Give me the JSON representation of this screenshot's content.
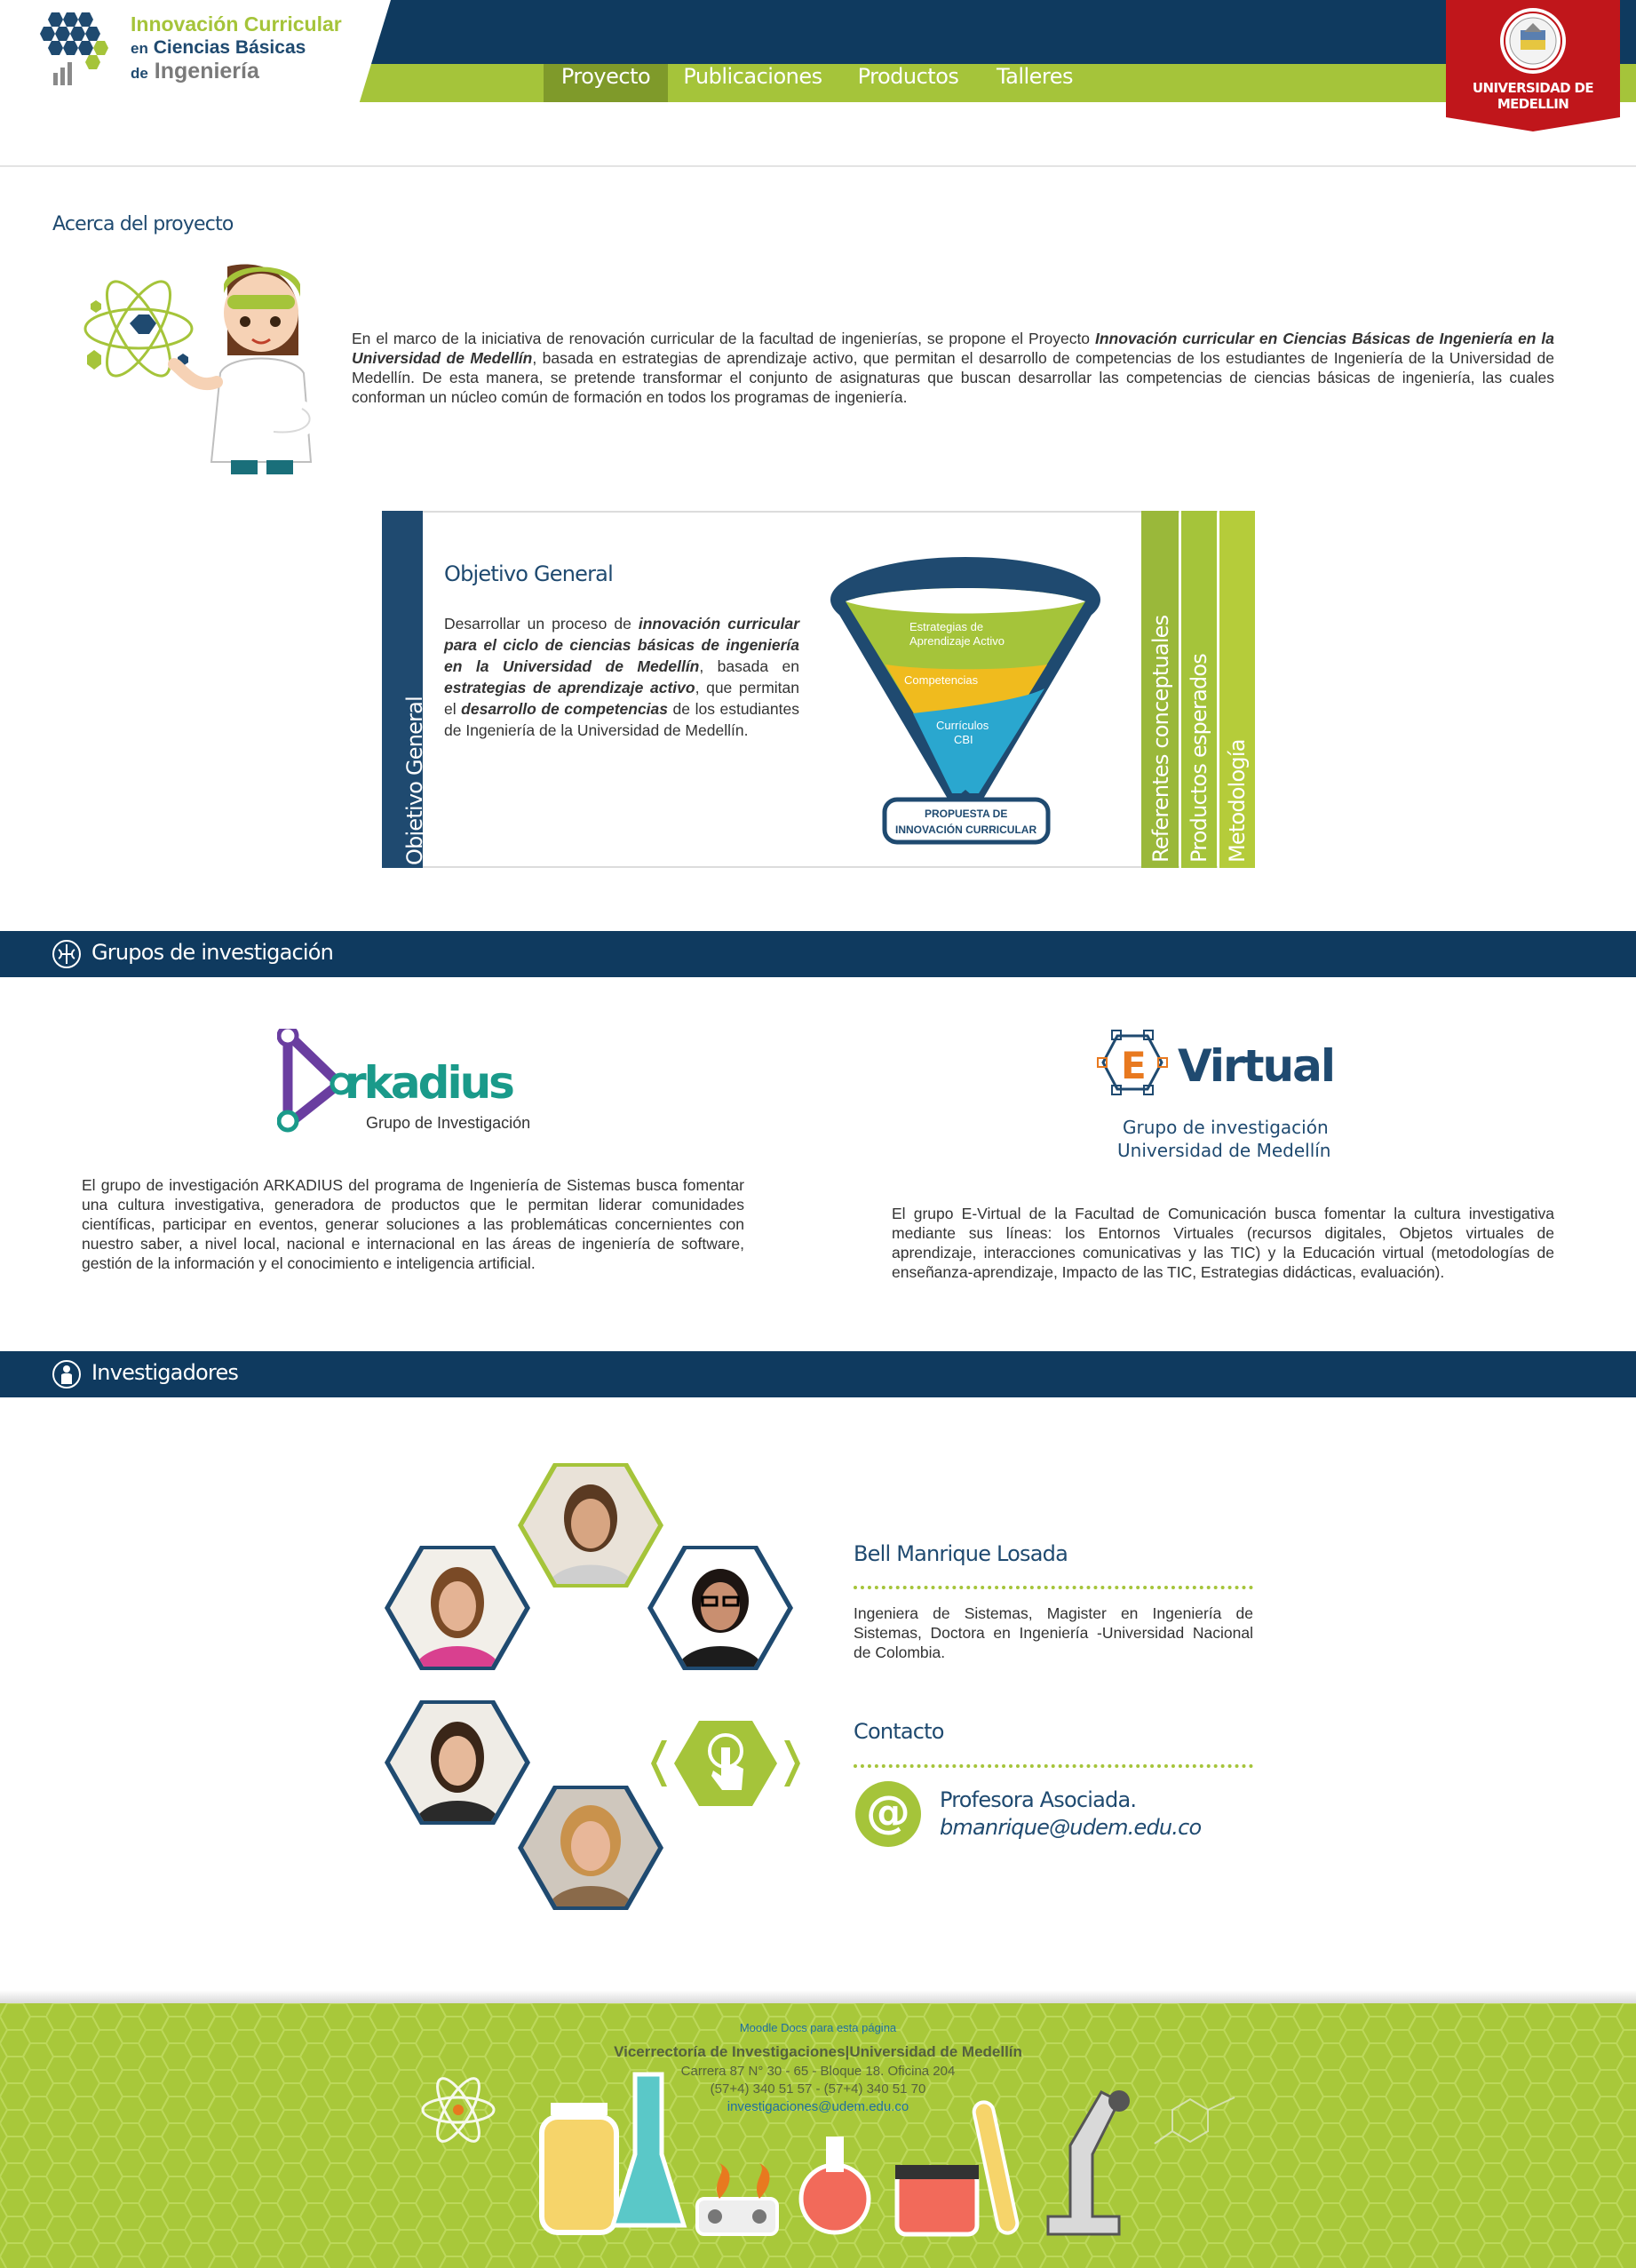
{
  "header": {
    "logo_line1": "Innovación Curricular",
    "logo_line2_prefix": "en",
    "logo_line2": "Ciencias Básicas",
    "logo_line3_prefix": "de",
    "logo_line3": "Ingeniería",
    "nav": [
      "Proyecto",
      "Publicaciones",
      "Productos",
      "Talleres"
    ],
    "active_nav": "Proyecto",
    "university_badge": "UNIVERSIDAD DE MEDELLIN"
  },
  "acerca": {
    "title": "Acerca del proyecto",
    "text_before": "En el marco de la iniciativa de renovación curricular de la facultad de ingenierías, se propone el Proyecto ",
    "text_bold": "Innovación curricular en Ciencias Básicas de Ingeniería en la Universidad de Medellín",
    "text_after": ", basada en estrategias de aprendizaje activo, que permitan el desarrollo de competencias de los estudiantes de Ingeniería de la Universidad de Medellín. De esta manera, se pretende transformar el conjunto de asignaturas que buscan desarrollar las competencias de ciencias básicas de ingeniería, las cuales conforman un núcleo común de formación en todos los programas de ingeniería."
  },
  "objetivo": {
    "side_label": "Objetivo General",
    "title": "Objetivo General",
    "p1": "Desarrollar un proceso de ",
    "b1": "innovación curricular para el ciclo de ciencias básicas de ingeniería en la Universidad de Medellín",
    "p2": ", basada en ",
    "b2": "estrategias de aprendizaje activo",
    "p3": ", que permitan el ",
    "b3": "desarrollo de competencias",
    "p4": " de los estudiantes de Ingeniería de la Universidad de Medellín.",
    "funnel": {
      "layer1_line1": "Estrategias de",
      "layer1_line2": "Aprendizaje Activo",
      "layer2": "Competencias",
      "layer3_line1": "Currículos",
      "layer3_line2": "CBI",
      "base_line1": "PROPUESTA DE",
      "base_line2": "INNOVACIÓN CURRICULAR"
    },
    "tabs": [
      "Referentes conceptuales",
      "Productos esperados",
      "Metodología"
    ]
  },
  "grupos": {
    "title": "Grupos de investigación",
    "arkadius_logo": "rkadius",
    "arkadius_sub": "Grupo de Investigación",
    "arkadius_text": "El grupo de investigación ARKADIUS del programa de Ingeniería de Sistemas busca fomentar una cultura investigativa, generadora de productos que le permitan liderar comunidades científicas, participar en eventos, generar soluciones a las problemáticas concernientes con nuestro saber, a nivel local, nacional e internacional en las áreas de ingeniería de software, gestión de la información y el conocimiento e inteligencia artificial.",
    "evirtual_logo": "Virtual",
    "evirtual_letter": "E",
    "evirtual_sub1": "Grupo de investigación",
    "evirtual_sub2": "Universidad de Medellín",
    "evirtual_text": "El grupo E-Virtual de la Facultad de Comunicación busca fomentar la cultura investigativa mediante sus líneas: los Entornos Virtuales (recursos digitales, Objetos virtuales de aprendizaje, interacciones comunicativas y las TIC) y la Educación virtual (metodologías de enseñanza-aprendizaje, Impacto de las TIC, Estrategias didácticas, evaluación)."
  },
  "investigadores": {
    "title": "Investigadores",
    "name": "Bell Manrique Losada",
    "bio": "Ingeniera de Sistemas, Magister en Ingeniería de Sistemas, Doctora en Ingeniería -Universidad Nacional de Colombia.",
    "contact_title": "Contacto",
    "role": "Profesora Asociada.",
    "email": "bmanrique@udem.edu.co"
  },
  "footer": {
    "moodle": "Moodle Docs para esta página",
    "org": "Vicerrectoría de Investigaciones|Universidad de Medellín",
    "address": "Carrera 87 N° 30 - 65 - Bloque 18. Oficina 204",
    "phone": "(57+4) 340 51 57 - (57+4) 340 51 70",
    "email": "investigaciones@udem.edu.co"
  },
  "colors": {
    "navy": "#0f3a5f",
    "green": "#a5c43a",
    "title_blue": "#1f4a70",
    "red": "#c0161b"
  }
}
